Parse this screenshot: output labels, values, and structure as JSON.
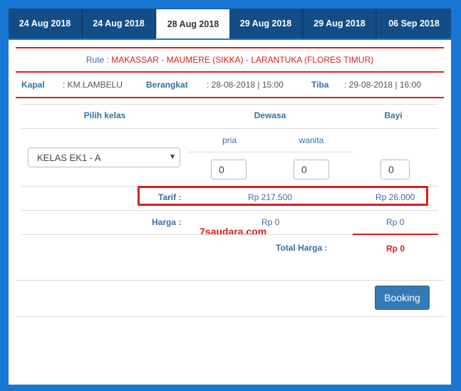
{
  "tabs": [
    {
      "label": "24 Aug 2018",
      "active": false
    },
    {
      "label": "24 Aug 2018",
      "active": false
    },
    {
      "label": "28 Aug 2018",
      "active": true
    },
    {
      "label": "29 Aug 2018",
      "active": false
    },
    {
      "label": "29 Aug 2018",
      "active": false
    },
    {
      "label": "06 Sep 2018",
      "active": false
    }
  ],
  "route": {
    "label": "Rute :",
    "origin": "MAKASSAR",
    "sep1": "-",
    "via": "MAUMERE (SIKKA)",
    "sep2": "-",
    "destination": "LARANTUKA (FLORES TIMUR)"
  },
  "voyage": {
    "ship_label": "Kapal",
    "ship_value": ": KM.LAMBELU",
    "depart_label": "Berangkat",
    "depart_value": ": 28-08-2018 | 15:00",
    "arrive_label": "Tiba",
    "arrive_value": ": 29-08-2018 | 16:00"
  },
  "table": {
    "col_class": "Pilih kelas",
    "col_adult": "Dewasa",
    "col_infant": "Bayi",
    "sub_male": "pria",
    "sub_female": "wanita",
    "selected_class": "KELAS EK1 - A",
    "qty_male": "0",
    "qty_female": "0",
    "qty_infant": "0",
    "tarif_label": "Tarif :",
    "tarif_adult": "Rp 217.500",
    "tarif_infant": "Rp 26.000",
    "harga_label": "Harga :",
    "harga_adult": "Rp 0",
    "harga_infant": "Rp 0",
    "total_label": "Total Harga :",
    "total_value": "Rp 0"
  },
  "watermark": "7saudara.com",
  "booking_label": "Booking",
  "colors": {
    "primary": "#1877d2",
    "tab_bg": "#134d86",
    "accent_red": "#d42020",
    "link_blue": "#3a6ea5"
  }
}
